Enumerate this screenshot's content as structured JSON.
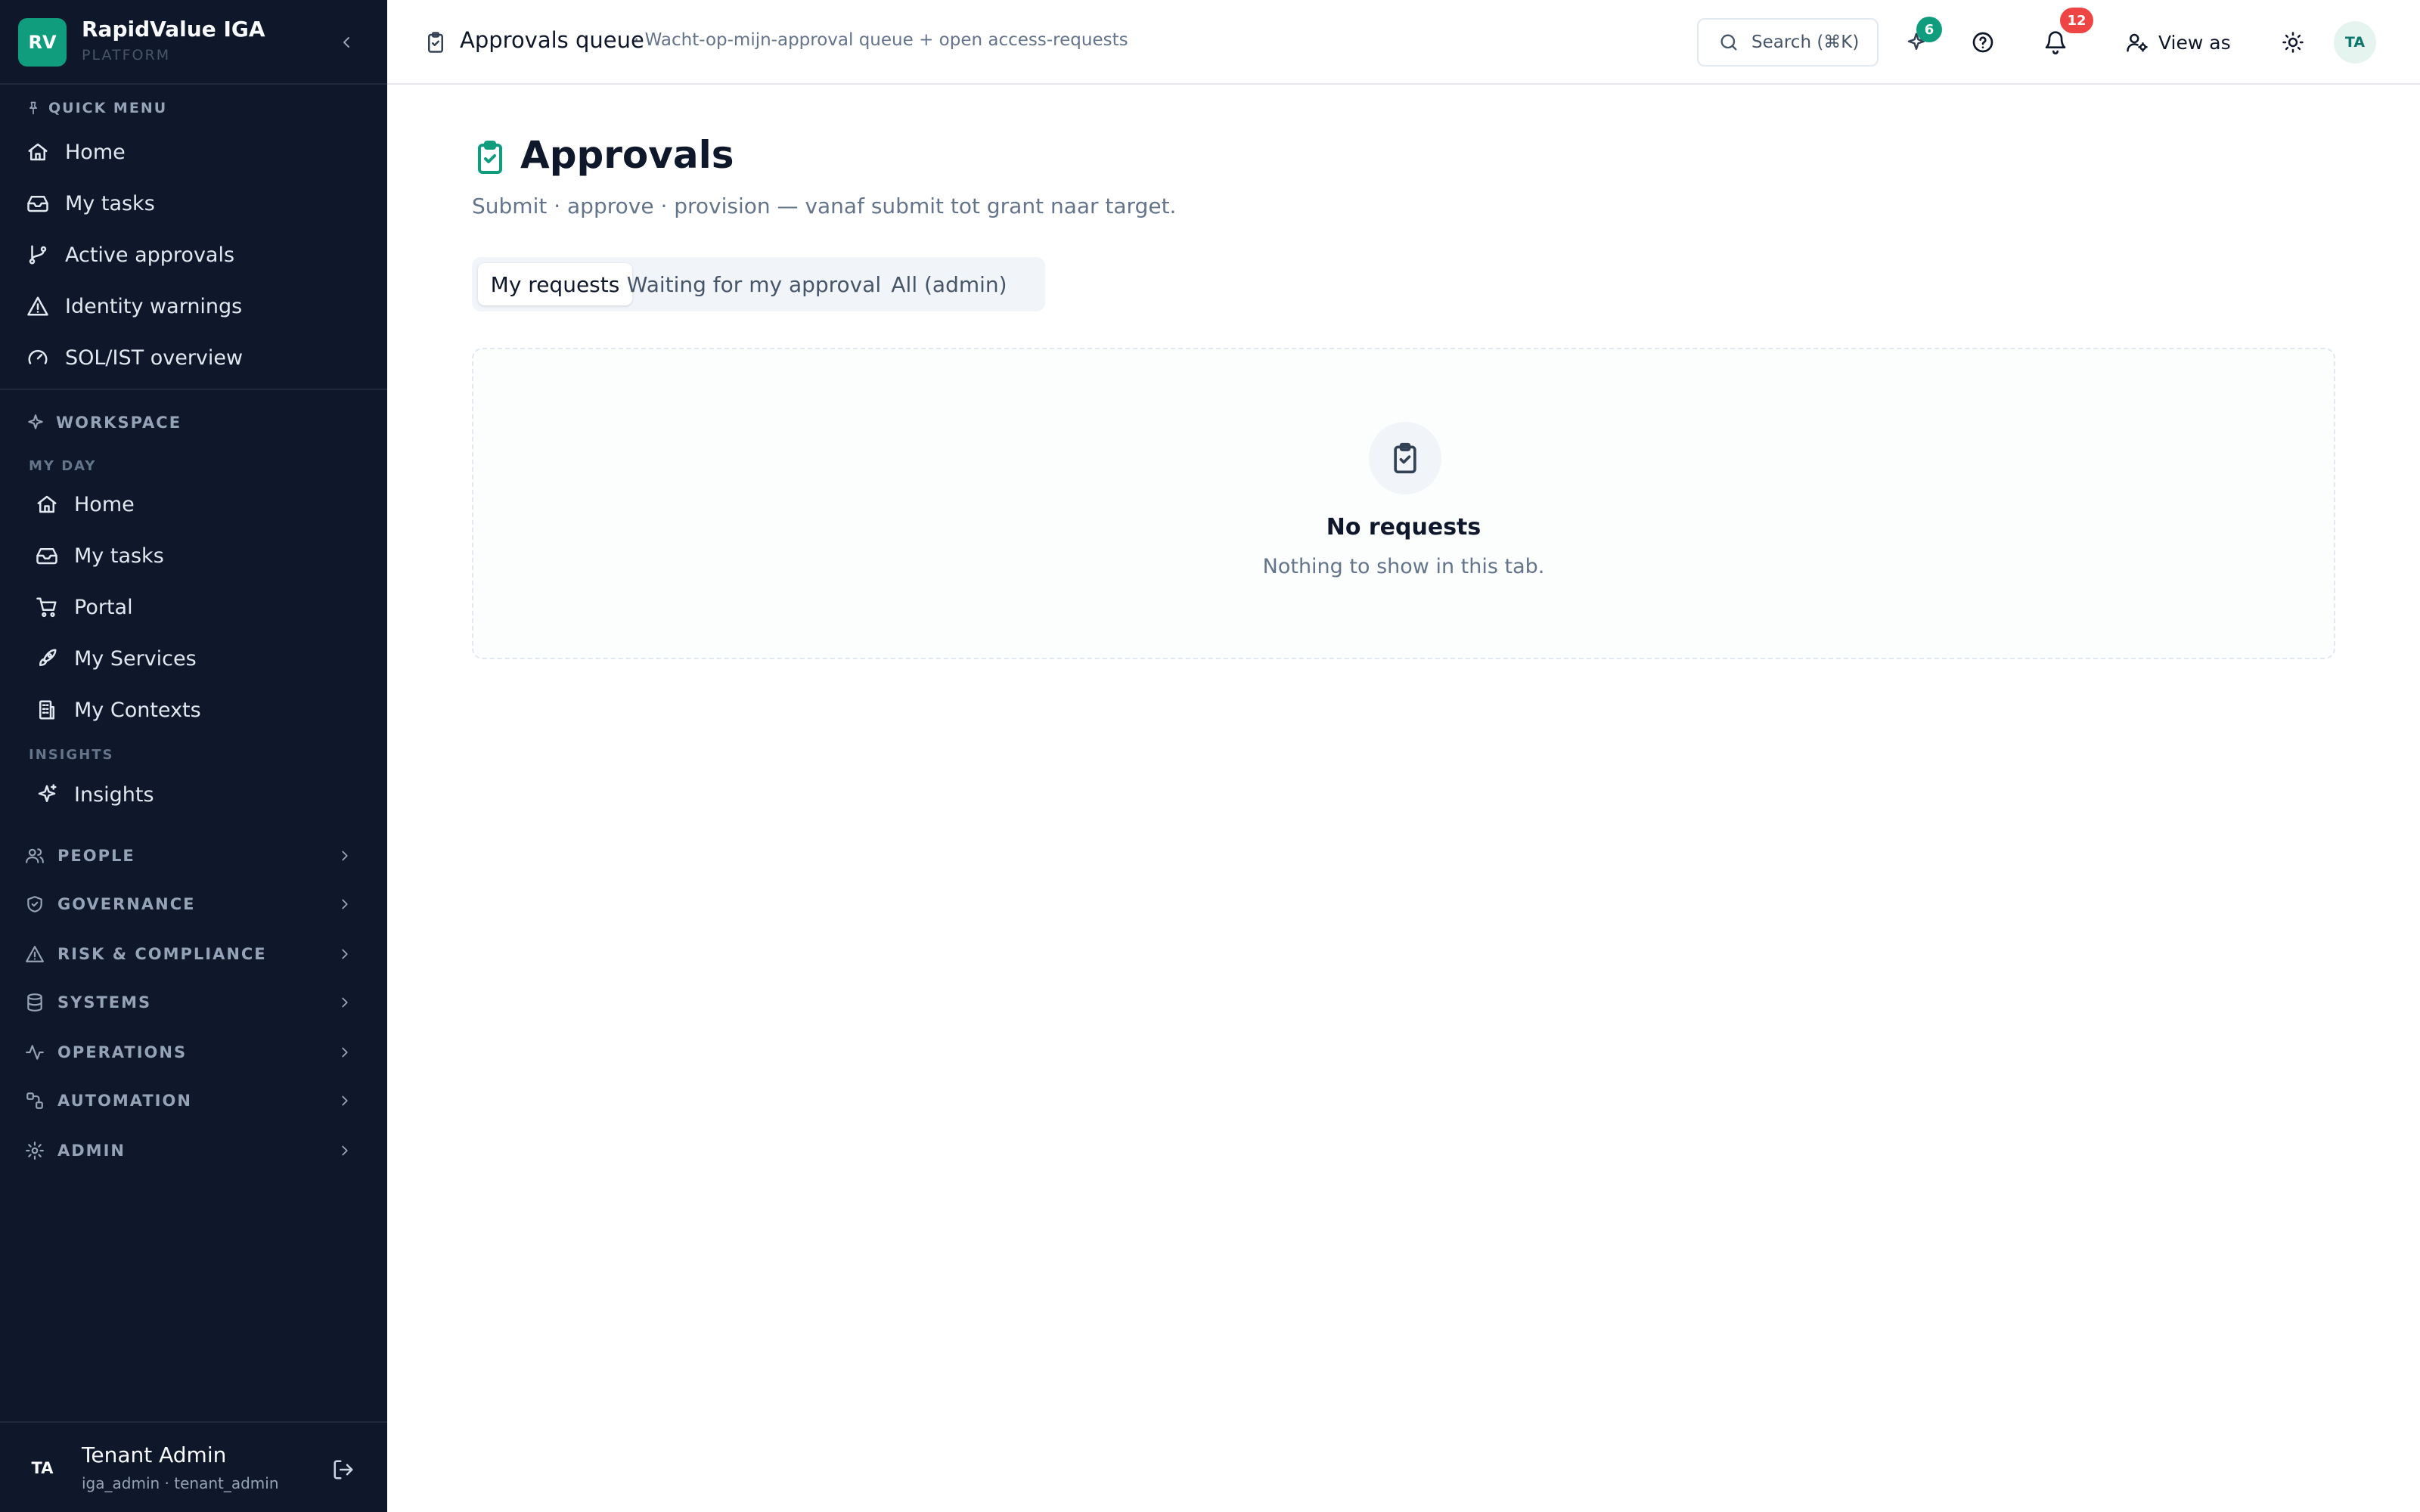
{
  "brand": {
    "logo_text": "RV",
    "name": "RapidValue IGA",
    "subtitle": "PLATFORM"
  },
  "quick_menu": {
    "title": "QUICK MENU",
    "items": [
      {
        "label": "Home",
        "icon": "home-icon"
      },
      {
        "label": "My tasks",
        "icon": "inbox-icon"
      },
      {
        "label": "Active approvals",
        "icon": "git-branch-icon"
      },
      {
        "label": "Identity warnings",
        "icon": "warning-triangle-icon"
      },
      {
        "label": "SOL/IST overview",
        "icon": "gauge-icon"
      }
    ]
  },
  "workspace": {
    "title": "WORKSPACE",
    "my_day_heading": "MY DAY",
    "my_day_items": [
      {
        "label": "Home",
        "icon": "home-icon"
      },
      {
        "label": "My tasks",
        "icon": "inbox-icon"
      },
      {
        "label": "Portal",
        "icon": "cart-icon"
      },
      {
        "label": "My Services",
        "icon": "rocket-icon"
      },
      {
        "label": "My Contexts",
        "icon": "building-icon"
      }
    ],
    "insights_heading": "INSIGHTS",
    "insights_items": [
      {
        "label": "Insights",
        "icon": "sparkles-icon"
      }
    ]
  },
  "groups": [
    {
      "label": "PEOPLE",
      "icon": "users-icon"
    },
    {
      "label": "GOVERNANCE",
      "icon": "shield-icon"
    },
    {
      "label": "RISK & COMPLIANCE",
      "icon": "warning-triangle-icon"
    },
    {
      "label": "SYSTEMS",
      "icon": "database-icon"
    },
    {
      "label": "OPERATIONS",
      "icon": "activity-icon"
    },
    {
      "label": "AUTOMATION",
      "icon": "workflow-icon"
    },
    {
      "label": "ADMIN",
      "icon": "gear-icon"
    }
  ],
  "user": {
    "initials": "TA",
    "name": "Tenant Admin",
    "meta": "iga_admin · tenant_admin"
  },
  "topbar": {
    "title": "Approvals queue",
    "subtitle": "· Wacht-op-mijn-approval queue + open access-requests",
    "search_label": "Search (⌘K)",
    "pinned_count": "6",
    "notification_count": "12",
    "view_as_label": "View as",
    "avatar_initials": "TA"
  },
  "page": {
    "title": "Approvals",
    "subtitle": "Submit · approve · provision — vanaf submit tot grant naar target.",
    "tabs": [
      {
        "label": "My requests",
        "active": true
      },
      {
        "label": "Waiting for my approval",
        "active": false
      },
      {
        "label": "All (admin)",
        "active": false
      }
    ],
    "empty_title": "No requests",
    "empty_text": "Nothing to show in this tab."
  },
  "colors": {
    "sidebar_bg": "#0f172a",
    "accent": "#0f9d7e",
    "danger": "#ef4444"
  }
}
